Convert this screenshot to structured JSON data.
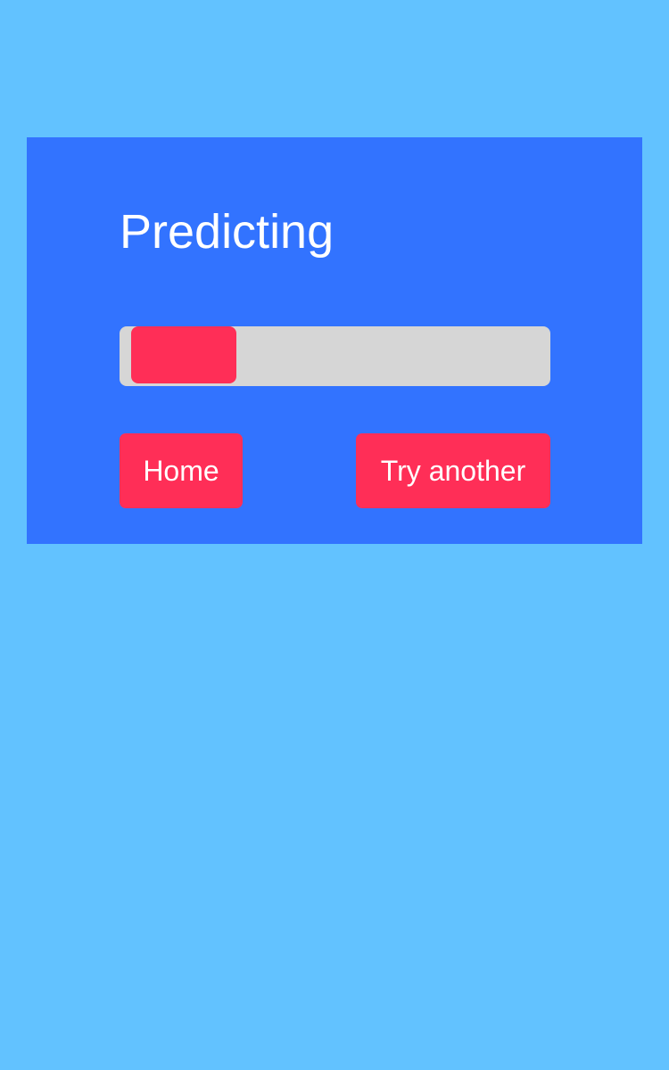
{
  "colors": {
    "page_background": "#62c2ff",
    "card_background": "#3273ff",
    "accent": "#ff2e57",
    "track": "#d6d6d6"
  },
  "status": {
    "title": "Predicting",
    "progress_fraction": 0.25
  },
  "actions": {
    "home_label": "Home",
    "try_another_label": "Try another"
  }
}
